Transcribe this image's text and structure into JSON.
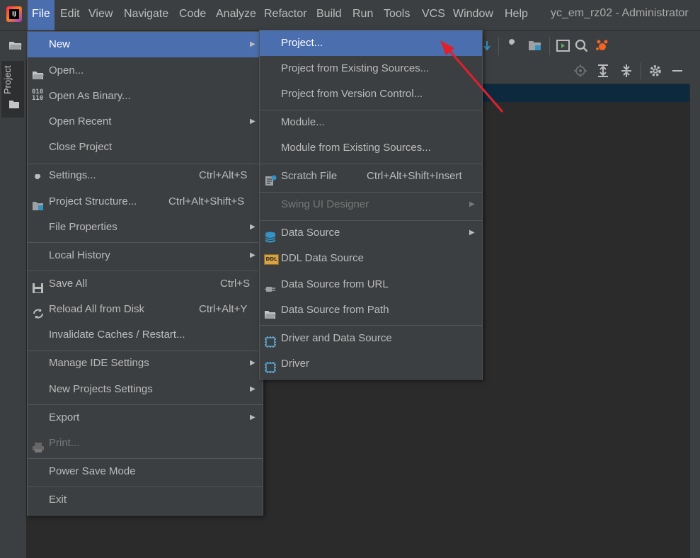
{
  "window_title": "yc_em_rz02 - Administrator",
  "menubar": [
    "File",
    "Edit",
    "View",
    "Navigate",
    "Code",
    "Analyze",
    "Refactor",
    "Build",
    "Run",
    "Tools",
    "VCS",
    "Window",
    "Help"
  ],
  "project_tab": "Project",
  "file_menu": {
    "new": "New",
    "open": "Open...",
    "open_binary": "Open As Binary...",
    "open_recent": "Open Recent",
    "close_project": "Close Project",
    "settings": "Settings...",
    "settings_sc": "Ctrl+Alt+S",
    "project_structure": "Project Structure...",
    "project_structure_sc": "Ctrl+Alt+Shift+S",
    "file_properties": "File Properties",
    "local_history": "Local History",
    "save_all": "Save All",
    "save_all_sc": "Ctrl+S",
    "reload": "Reload All from Disk",
    "reload_sc": "Ctrl+Alt+Y",
    "invalidate": "Invalidate Caches / Restart...",
    "manage_ide": "Manage IDE Settings",
    "new_projects_settings": "New Projects Settings",
    "export": "Export",
    "print": "Print...",
    "power_save": "Power Save Mode",
    "exit": "Exit"
  },
  "new_menu": {
    "project": "Project...",
    "project_existing": "Project from Existing Sources...",
    "project_vcs": "Project from Version Control...",
    "module": "Module...",
    "module_existing": "Module from Existing Sources...",
    "scratch": "Scratch File",
    "scratch_sc": "Ctrl+Alt+Shift+Insert",
    "swing": "Swing UI Designer",
    "data_source": "Data Source",
    "ddl": "DDL Data Source",
    "ds_url": "Data Source from URL",
    "ds_path": "Data Source from Path",
    "driver_ds": "Driver and Data Source",
    "driver": "Driver"
  },
  "colors": {
    "accent": "#4b6eaf",
    "background": "#2b2b2b",
    "panel": "#3c3f41",
    "annotation": "#e0202a"
  }
}
